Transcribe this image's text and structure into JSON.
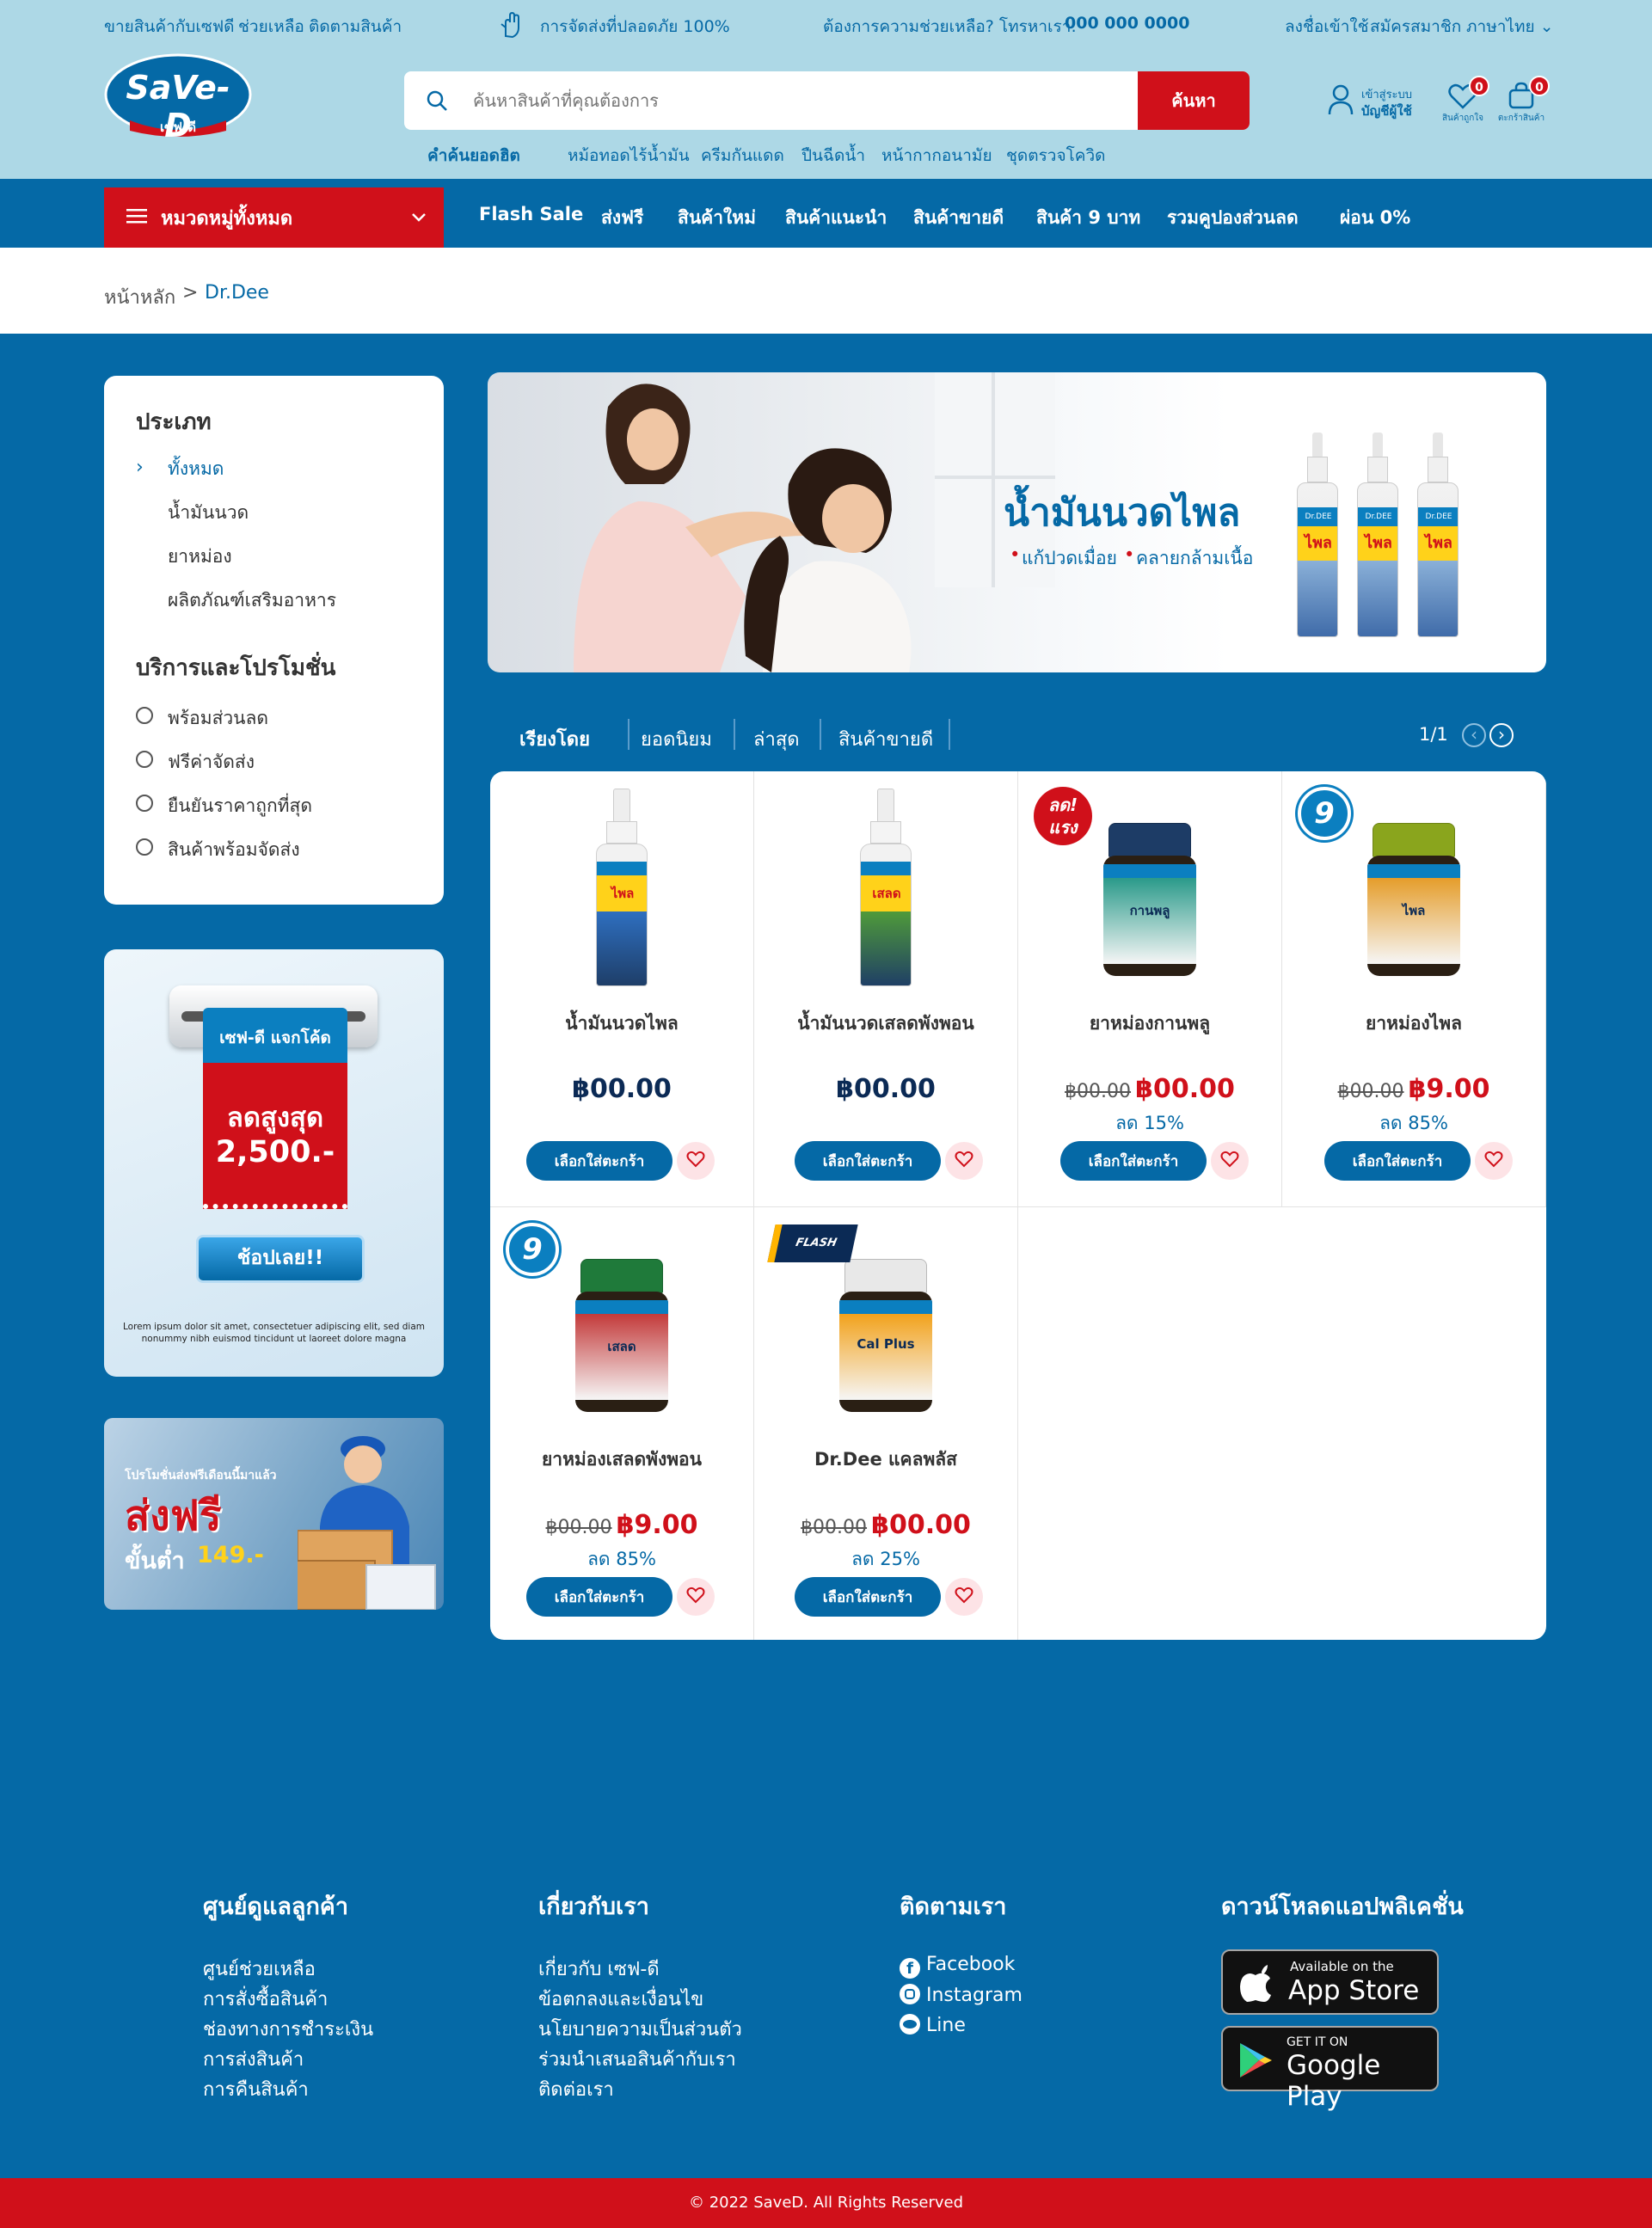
{
  "topbar": {
    "links": [
      "ขายสินค้ากับเซฟดี",
      "ช่วยเหลือ",
      "ติดตามสินค้า"
    ],
    "safe_delivery": "การจัดส่งที่ปลอดภัย 100%",
    "help_text": "ต้องการความช่วยเหลือ? โทรหาเรา:",
    "phone": "000 000 0000",
    "login": "ลงชื่อเข้าใช้",
    "register": "สมัครสมาชิก",
    "language": "ภาษาไทย"
  },
  "logo": {
    "text": "SaVe-D",
    "sub": "เซฟ-ดี"
  },
  "search": {
    "placeholder": "ค้นหาสินค้าที่คุณต้องการ",
    "button": "ค้นหา"
  },
  "hot_searches": {
    "label": "คำค้นยอดฮิต",
    "items": [
      "หม้อทอดไร้น้ำมัน",
      "ครีมกันแดด",
      "ปืนฉีดน้ำ",
      "หน้ากากอนามัย",
      "ชุดตรวจโควิด"
    ]
  },
  "account": {
    "line1": "เข้าสู่ระบบ",
    "line2": "บัญชีผู้ใช้"
  },
  "wishlist": {
    "label": "สินค้าถูกใจ",
    "count": "0"
  },
  "cart": {
    "label": "ตะกร้าสินค้า",
    "count": "0"
  },
  "nav": {
    "categories_label": "หมวดหมู่ทั้งหมด",
    "links": [
      "Flash Sale",
      "ส่งฟรี",
      "สินค้าใหม่",
      "สินค้าแนะนำ",
      "สินค้าขายดี",
      "สินค้า 9 บาท",
      "รวมคูปองส่วนลด",
      "ผ่อน 0%"
    ]
  },
  "breadcrumb": {
    "home": "หน้าหลัก",
    "separator": ">",
    "current": "Dr.Dee"
  },
  "sidebar": {
    "type_title": "ประเภท",
    "types": [
      "ทั้งหมด",
      "น้ำมันนวด",
      "ยาหม่อง",
      "ผลิตภัณฑ์เสริมอาหาร"
    ],
    "service_title": "บริการและโปรโมชั่น",
    "services": [
      "พร้อมส่วนลด",
      "ฟรีค่าจัดส่ง",
      "ยืนยันราคาถูกที่สุด",
      "สินค้าพร้อมจัดส่ง"
    ]
  },
  "promo_coupon": {
    "title": "เซฟ-ดี แจกโค้ด",
    "line1": "ลดสูงสุด",
    "line2": "2,500.-",
    "button": "ช้อปเลย!!",
    "text": "Lorem ipsum dolor sit amet, consectetuer adipiscing elit, sed diam nonummy nibh euismod tincidunt ut laoreet dolore magna"
  },
  "promo_shipping": {
    "small": "โปรโมชั่นส่งฟรีเดือนนี้มาแล้ว",
    "big": "ส่งฟรี",
    "min_label": "ขั้นต่ำ",
    "min_value": "149.-"
  },
  "banner": {
    "title": "น้ำมันนวดไพล",
    "points": [
      "แก้ปวดเมื่อย",
      "คลายกล้ามเนื้อ"
    ],
    "bottle_label": "ไพล",
    "bottle_brand": "Dr.DEE"
  },
  "sort": {
    "label": "เรียงโดย",
    "options": [
      "ยอดนิยม",
      "ล่าสุด",
      "สินค้าขายดี"
    ],
    "page": "1/1"
  },
  "cart_button_label": "เลือกใส่ตะกร้า",
  "products": [
    {
      "name": "น้ำมันนวดไพล",
      "price": "฿00.00",
      "old_price": "",
      "discount": "",
      "badge": "",
      "kind": "spray",
      "label_color": "#2e6fc0",
      "label_text": "ไพล"
    },
    {
      "name": "น้ำมันนวดเสลดพังพอน",
      "price": "฿00.00",
      "old_price": "",
      "discount": "",
      "badge": "",
      "kind": "spray",
      "label_color": "#4f9a3a",
      "label_text": "เสลด"
    },
    {
      "name": "ยาหม่องกานพลู",
      "price": "฿00.00",
      "old_price": "฿00.00",
      "discount": "ลด 15%",
      "badge": "ลด! แรง",
      "kind": "jar",
      "lid_color": "#1d3c66",
      "label_color": "#2a9a8a",
      "label_text": "กานพลู"
    },
    {
      "name": "ยาหม่องไพล",
      "price": "฿9.00",
      "old_price": "฿00.00",
      "discount": "ลด 85%",
      "badge": "9",
      "kind": "jar",
      "lid_color": "#8aa51d",
      "label_color": "#e59d2b",
      "label_text": "ไพล"
    },
    {
      "name": "ยาหม่องเสลดพังพอน",
      "price": "฿9.00",
      "old_price": "฿00.00",
      "discount": "ลด 85%",
      "badge": "9",
      "kind": "jar",
      "lid_color": "#1f7a3a",
      "label_color": "#c33a3a",
      "label_text": "เสลด"
    },
    {
      "name": "Dr.Dee แคลพลัส",
      "price": "฿00.00",
      "old_price": "฿00.00",
      "discount": "ลด 25%",
      "badge": "FLASH SALE",
      "kind": "jar",
      "lid_color": "#e8e8e8",
      "label_color": "#f2a21c",
      "label_text": "Cal Plus"
    }
  ],
  "footer": {
    "columns": [
      {
        "title": "ศูนย์ดูแลลูกค้า",
        "links": [
          "ศูนย์ช่วยเหลือ",
          "การสั่งซื้อสินค้า",
          "ช่องทางการชำระเงิน",
          "การส่งสินค้า",
          "การคืนสินค้า"
        ]
      },
      {
        "title": "เกี่ยวกับเรา",
        "links": [
          "เกี่ยวกับ เซฟ-ดี",
          "ข้อตกลงและเงื่อนไข",
          "นโยบายความเป็นส่วนตัว",
          "ร่วมนำเสนอสินค้ากับเรา",
          "ติดต่อเรา"
        ]
      },
      {
        "title": "ติดตามเรา",
        "links": [
          "Facebook",
          "Instagram",
          "Line"
        ]
      },
      {
        "title": "ดาวน์โหลดแอปพลิเคชั่น",
        "links": []
      }
    ],
    "appstore_small": "Available on the",
    "appstore_big": "App Store",
    "googleplay_small": "GET IT ON",
    "googleplay_big": "Google Play",
    "copyright": "© 2022 SaveD. All Rights Reserved"
  },
  "colors": {
    "brand_blue": "#0569a6",
    "light_blue": "#add8e6",
    "brand_red": "#d0101a",
    "dark_navy": "#0b2a55"
  }
}
